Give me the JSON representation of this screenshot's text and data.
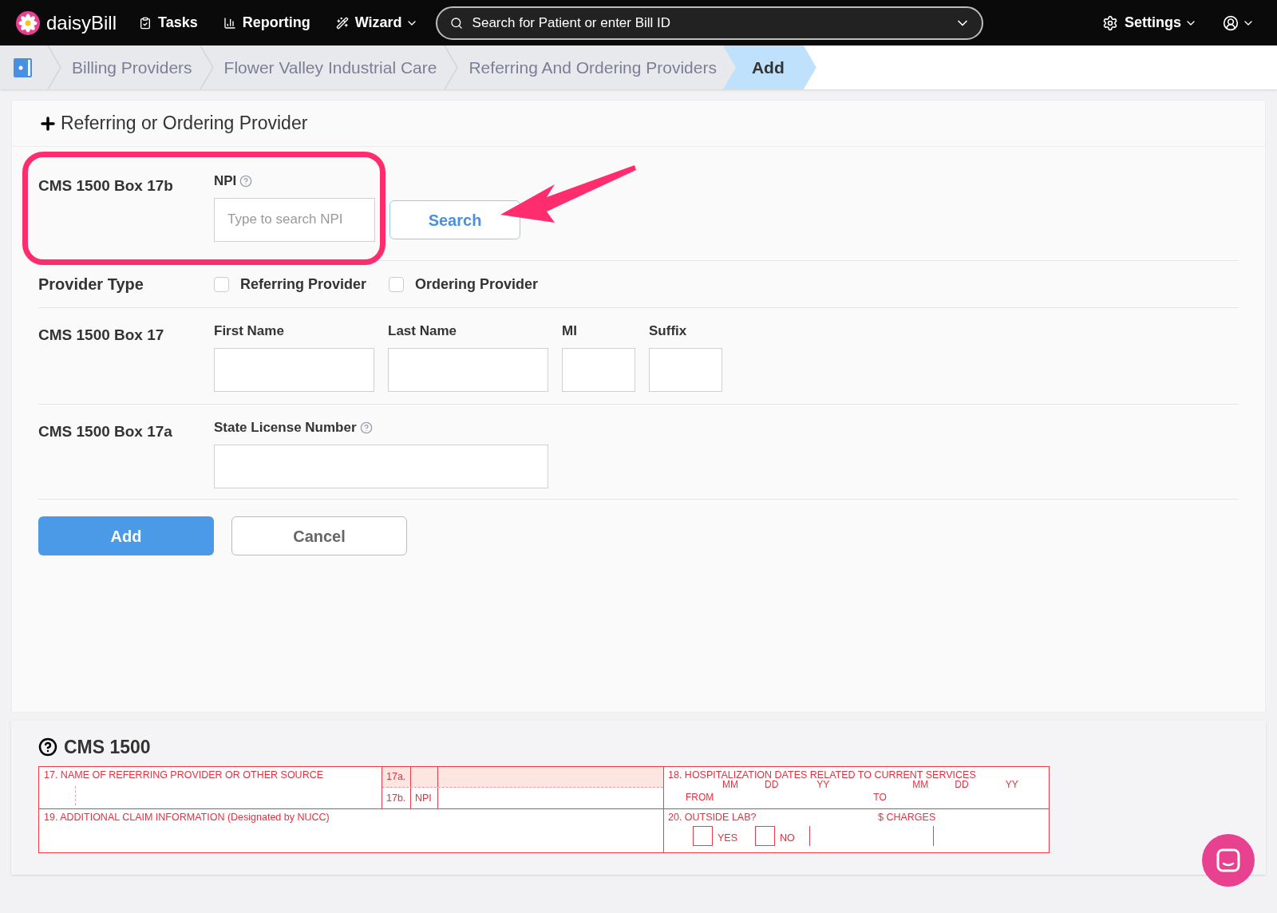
{
  "nav": {
    "logo": "daisy**Bill**",
    "items": [
      {
        "label": "Tasks",
        "kind": "tasks"
      },
      {
        "label": "Reporting",
        "kind": "reporting"
      },
      {
        "label": "Wizard",
        "kind": "wizard"
      }
    ],
    "search": {
      "placeholder": "Search for Patient or enter Bill ID"
    },
    "settings": "Settings"
  },
  "breadcrumb": [
    {
      "label": "Billing Providers",
      "selected": false
    },
    {
      "label": "Flower Valley Industrial Care",
      "selected": false
    },
    {
      "label": "Referring And Ordering Providers",
      "selected": false
    },
    {
      "label": "Add",
      "selected": true
    }
  ],
  "form": {
    "title": "Referring or Ordering Provider",
    "npi_row": {
      "label": "CMS 1500 Box 17b",
      "field_label": "NPI",
      "placeholder": "Type to search NPI",
      "button": "Search"
    },
    "provider_type": {
      "label": "Provider Type",
      "options": [
        {
          "label": "Referring Provider",
          "checked": false
        },
        {
          "label": "Ordering Provider",
          "checked": false
        }
      ]
    },
    "name_row": {
      "label": "CMS 1500 Box 17",
      "fields": [
        {
          "label": "First Name",
          "kind": "wide"
        },
        {
          "label": "Last Name",
          "kind": "wide"
        },
        {
          "label": "MI",
          "kind": "narrow"
        },
        {
          "label": "Suffix",
          "kind": "narrow"
        }
      ]
    },
    "license_row": {
      "label": "CMS 1500 Box 17a",
      "field_label": "State License Number"
    },
    "buttons": [
      {
        "label": "Add",
        "kind": "primary"
      },
      {
        "label": "Cancel",
        "kind": "secondary"
      }
    ]
  },
  "cms1500": {
    "title": "CMS 1500",
    "box17": "17. NAME OF REFERRING PROVIDER OR OTHER SOURCE",
    "box17a": "17a.",
    "box17b": "17b.",
    "npi": "NPI",
    "box18": "18. HOSPITALIZATION DATES RELATED TO CURRENT SERVICES",
    "date_parts": [
      "MM",
      "DD",
      "YY",
      "MM",
      "DD",
      "YY"
    ],
    "from": "FROM",
    "to": "TO",
    "box19": "19. ADDITIONAL CLAIM INFORMATION (Designated by NUCC)",
    "box20": "20. OUTSIDE LAB?",
    "charges": "$ CHARGES",
    "yes": "YES",
    "no": "NO",
    "yes_checked": false,
    "no_checked": false
  }
}
